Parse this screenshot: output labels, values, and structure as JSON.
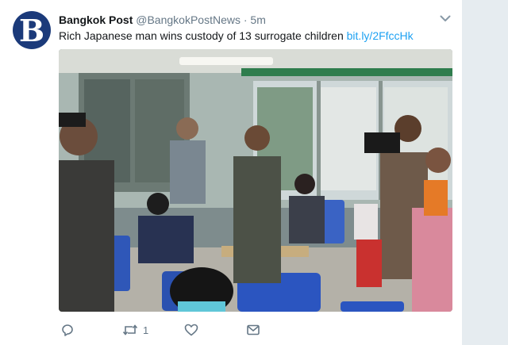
{
  "tweet": {
    "author_name": "Bangkok Post",
    "author_handle": "@BangkokPostNews",
    "separator": "·",
    "time": "5m",
    "avatar_letter": "B",
    "text": "Rich Japanese man wins custody of 13 surrogate children",
    "link": "bit.ly/2FfccHk"
  },
  "actions": {
    "reply_count": "",
    "retweet_count": "1",
    "like_count": ""
  },
  "colors": {
    "link": "#1da1f2",
    "secondary_text": "#657786",
    "avatar_bg": "#1b3a7a"
  },
  "icons": [
    "chevron-down-icon",
    "reply-icon",
    "retweet-icon",
    "like-icon",
    "message-icon"
  ]
}
